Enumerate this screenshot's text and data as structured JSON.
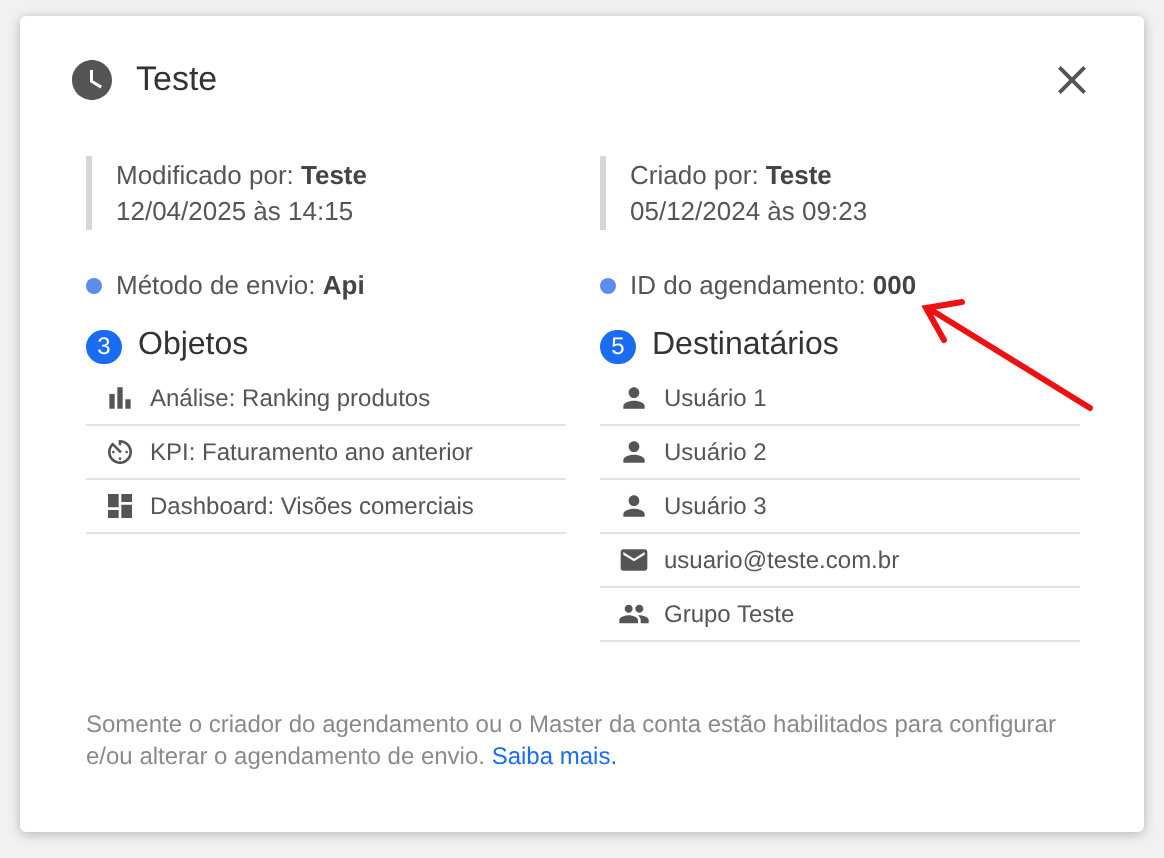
{
  "dialog": {
    "title": "Teste",
    "meta": [
      {
        "text": "Modificado por: **Teste**",
        "date": "12/04/2025 às 14:15"
      },
      {
        "text": "Criado por: **Teste**",
        "date": "05/12/2024 às 09:23"
      }
    ],
    "details": [
      {
        "text": "Método de envio: **Api**",
        "color": "#5b8def"
      },
      {
        "text": "ID do agendamento: **000**",
        "color": "#5b8def"
      }
    ],
    "sections": [
      {
        "count": "3",
        "title": "Objetos",
        "items": [
          {
            "kind": "chart",
            "text": "Análise: Ranking produtos"
          },
          {
            "kind": "kpi",
            "text": "KPI: Faturamento ano anterior"
          },
          {
            "kind": "dashboard",
            "text": "Dashboard: Visões comerciais"
          }
        ]
      },
      {
        "count": "5",
        "title": "Destinatários",
        "items": [
          {
            "kind": "user",
            "text": "Usuário 1"
          },
          {
            "kind": "user",
            "text": "Usuário 2"
          },
          {
            "kind": "user",
            "text": "Usuário 3"
          },
          {
            "kind": "email",
            "text": "usuario@teste.com.br"
          },
          {
            "kind": "group",
            "text": "Grupo Teste"
          }
        ]
      }
    ],
    "note": "Somente o criador do agendamento ou o Master da conta estão habilitados para configurar e/ou alterar o agendamento de envio.",
    "note_link": "Saiba mais."
  },
  "annotation": {
    "kind": "arrow"
  }
}
